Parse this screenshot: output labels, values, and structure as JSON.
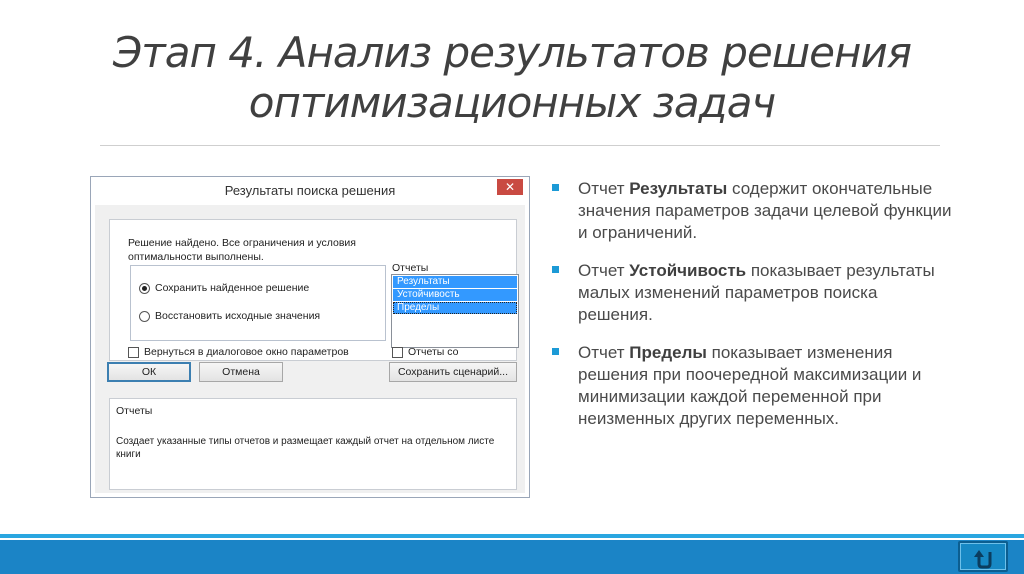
{
  "slide": {
    "title_line1": "Этап 4. Анализ результатов решения",
    "title_line2": "оптимизационных задач"
  },
  "dialog": {
    "title": "Результаты поиска решения",
    "close_glyph": "✕",
    "message_line1": "Решение найдено. Все ограничения и условия",
    "message_line2": "оптимальности выполнены.",
    "radio_keep": "Сохранить найденное решение",
    "radio_restore": "Восстановить исходные значения",
    "reports_label": "Отчеты",
    "reports": [
      "Результаты",
      "Устойчивость",
      "Пределы"
    ],
    "return_checkbox": "Вернуться в диалоговое окно параметров",
    "outline_reports_checkbox": "Отчеты со",
    "ok_button": "ОК",
    "cancel_button": "Отмена",
    "save_scenario_button": "Сохранить сценарий...",
    "description_title": "Отчеты",
    "description_text": "Создает указанные типы отчетов и размещает каждый отчет на отдельном листе книги"
  },
  "bullets": [
    {
      "prefix": "Отчет ",
      "bold": "Результаты",
      "text": " содержит окончательные значения параметров задачи целевой функции и ограничений."
    },
    {
      "prefix": "Отчет ",
      "bold": "Устойчивость",
      "text": " показывает результаты малых изменений параметров поиска решения."
    },
    {
      "prefix": "Отчет ",
      "bold": "Пределы",
      "text": " показывает изменения решения при поочередной максимизации и минимизации каждой переменной при неизменных других переменных."
    }
  ],
  "colors": {
    "accent": "#1c9ad6",
    "footer": "#1b84c6",
    "selection": "#3399ff"
  },
  "icons": {
    "back": "back-arrow-icon"
  }
}
